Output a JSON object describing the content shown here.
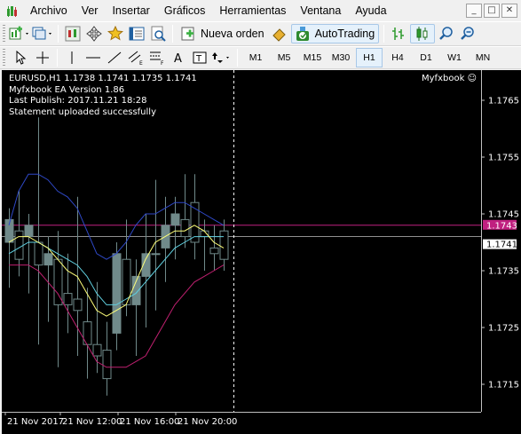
{
  "menu": {
    "items": [
      "Archivo",
      "Ver",
      "Insertar",
      "Gráficos",
      "Herramientas",
      "Ventana",
      "Ayuda"
    ],
    "window_controls": [
      "_",
      "□",
      "✕"
    ]
  },
  "toolbar1": {
    "new_order_label": "Nueva orden",
    "autotrading_label": "AutoTrading"
  },
  "toolbar2": {
    "timeframes": [
      "M1",
      "M5",
      "M15",
      "M30",
      "H1",
      "H4",
      "D1",
      "W1",
      "MN"
    ],
    "active_timeframe": "H1"
  },
  "chart": {
    "symbol_line": "EURUSD,H1  1.1738 1.1741 1.1735 1.1741",
    "ea_line": "Myfxbook EA Version 1.86",
    "publish_line": "Last Publish: 2017.11.21 18:28",
    "status_line": "Statement uploaded successfully",
    "logo_text": "Myfxbook",
    "price_labels": [
      "1.1765",
      "1.1755",
      "1.1745",
      "1.1735",
      "1.1725",
      "1.1715"
    ],
    "price_values": [
      1.1765,
      1.1755,
      1.1745,
      1.1735,
      1.1725,
      1.1715
    ],
    "ask_label": "1.1743",
    "ask_value": 1.1743,
    "bid_label": "1.1741",
    "bid_value": 1.1741,
    "time_labels": [
      "21 Nov 2017",
      "21 Nov 12:00",
      "21 Nov 16:00",
      "21 Nov 20:00"
    ],
    "colors": {
      "background": "#000000",
      "bull": "#708a8a",
      "bear": "#708a8a",
      "ma_blue": "#2f49c8",
      "ma_yellow": "#ffff7a",
      "ma_cyan": "#60d0e0",
      "ma_magenta": "#c02070",
      "ask_line": "#c02080",
      "bid_line": "#c0c0c0"
    },
    "candles": [
      {
        "o": 1.174,
        "h": 1.1746,
        "l": 1.1732,
        "c": 1.1744
      },
      {
        "o": 1.1742,
        "h": 1.1749,
        "l": 1.1734,
        "c": 1.1737
      },
      {
        "o": 1.1741,
        "h": 1.1745,
        "l": 1.1731,
        "c": 1.1743
      },
      {
        "o": 1.174,
        "h": 1.1762,
        "l": 1.1722,
        "c": 1.1736
      },
      {
        "o": 1.1736,
        "h": 1.1741,
        "l": 1.1726,
        "c": 1.1738
      },
      {
        "o": 1.1737,
        "h": 1.1742,
        "l": 1.1718,
        "c": 1.1729
      },
      {
        "o": 1.1731,
        "h": 1.1738,
        "l": 1.1724,
        "c": 1.1729
      },
      {
        "o": 1.173,
        "h": 1.1748,
        "l": 1.172,
        "c": 1.1728
      },
      {
        "o": 1.1726,
        "h": 1.1732,
        "l": 1.1716,
        "c": 1.1722
      },
      {
        "o": 1.1722,
        "h": 1.1733,
        "l": 1.1717,
        "c": 1.172
      },
      {
        "o": 1.1721,
        "h": 1.1726,
        "l": 1.1713,
        "c": 1.1716
      },
      {
        "o": 1.1724,
        "h": 1.174,
        "l": 1.1721,
        "c": 1.1738
      },
      {
        "o": 1.1737,
        "h": 1.1744,
        "l": 1.1727,
        "c": 1.1729
      },
      {
        "o": 1.1729,
        "h": 1.1737,
        "l": 1.172,
        "c": 1.1734
      },
      {
        "o": 1.1734,
        "h": 1.1745,
        "l": 1.1725,
        "c": 1.1738
      },
      {
        "o": 1.1738,
        "h": 1.1751,
        "l": 1.1728,
        "c": 1.1738
      },
      {
        "o": 1.1739,
        "h": 1.1748,
        "l": 1.1733,
        "c": 1.1743
      },
      {
        "o": 1.1743,
        "h": 1.1748,
        "l": 1.1737,
        "c": 1.1745
      },
      {
        "o": 1.1744,
        "h": 1.1752,
        "l": 1.1739,
        "c": 1.1741
      },
      {
        "o": 1.1747,
        "h": 1.1752,
        "l": 1.1737,
        "c": 1.174
      },
      {
        "o": 1.1742,
        "h": 1.1744,
        "l": 1.1735,
        "c": 1.1741
      },
      {
        "o": 1.1739,
        "h": 1.1743,
        "l": 1.1735,
        "c": 1.1738
      },
      {
        "o": 1.1742,
        "h": 1.1744,
        "l": 1.1735,
        "c": 1.1737
      }
    ],
    "ma_blue": [
      1.1743,
      1.1749,
      1.1752,
      1.1752,
      1.1751,
      1.1749,
      1.1748,
      1.1746,
      1.1742,
      1.1738,
      1.1737,
      1.1738,
      1.174,
      1.1743,
      1.1745,
      1.1745,
      1.1746,
      1.1747,
      1.1747,
      1.1746,
      1.1745,
      1.1744,
      1.1743
    ],
    "ma_yellow": [
      1.174,
      1.1741,
      1.1741,
      1.174,
      1.1739,
      1.1737,
      1.1735,
      1.1734,
      1.1731,
      1.1728,
      1.1727,
      1.1728,
      1.1729,
      1.1733,
      1.1737,
      1.174,
      1.1741,
      1.1742,
      1.1742,
      1.1743,
      1.1742,
      1.174,
      1.1739
    ],
    "ma_cyan": [
      1.1738,
      1.1739,
      1.174,
      1.174,
      1.1739,
      1.1738,
      1.1737,
      1.1736,
      1.1734,
      1.1731,
      1.1729,
      1.1729,
      1.173,
      1.1731,
      1.1733,
      1.1735,
      1.1737,
      1.1739,
      1.174,
      1.1741,
      1.1741,
      1.1741,
      1.1741
    ],
    "ma_magenta": [
      1.1736,
      1.1736,
      1.1736,
      1.1735,
      1.1733,
      1.1731,
      1.1728,
      1.1725,
      1.1722,
      1.1719,
      1.1718,
      1.1718,
      1.1718,
      1.1719,
      1.172,
      1.1723,
      1.1726,
      1.1729,
      1.1731,
      1.1733,
      1.1734,
      1.1735,
      1.1736
    ]
  }
}
